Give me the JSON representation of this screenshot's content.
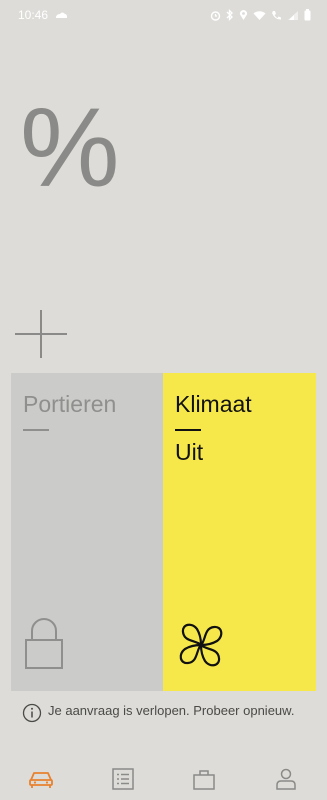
{
  "status_bar": {
    "time": "10:46",
    "icons": [
      "weather-icon",
      "alarm-icon",
      "bluetooth-icon",
      "location-icon",
      "wifi-icon",
      "call-icon",
      "signal-icon",
      "battery-icon"
    ]
  },
  "charge": {
    "value_text": "%"
  },
  "tiles": {
    "doors": {
      "title": "Portieren",
      "icon": "lock-icon"
    },
    "climate": {
      "title": "Klimaat",
      "status": "Uit",
      "icon": "fan-icon"
    }
  },
  "notice": {
    "text": "Je aanvraag is verlopen. Probeer opnieuw."
  },
  "bottom_nav": {
    "items": [
      "car-icon",
      "list-icon",
      "shop-icon",
      "profile-icon"
    ],
    "active_index": 0
  },
  "colors": {
    "background": "#dddcd8",
    "climate_tile": "#f6e84b",
    "doors_tile": "#cbcbc9",
    "active_nav": "#e8812e",
    "inactive": "#8a8a88"
  }
}
